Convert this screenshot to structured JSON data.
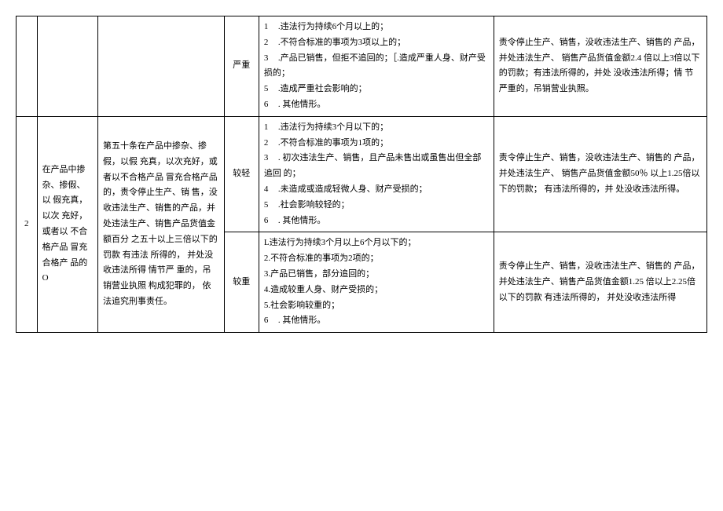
{
  "rows": [
    {
      "num": "",
      "violation": "",
      "basis": "",
      "severity": "严重",
      "circumstances_items": [
        {
          "n": "1",
          "t": ".违法行为持续6个月以上的；"
        },
        {
          "n": "2",
          "t": ".不符合标准的事项为3项以上的；"
        },
        {
          "n": "3",
          "t": ".产品已销售，但拒不追回的；［.造成严重人身、财产受损的；"
        },
        {
          "n": "5",
          "t": ".造成严重社会影响的；"
        },
        {
          "n": "6",
          "t": ". 其他情形。"
        }
      ],
      "penalty": "责令停止生产、销售，没收违法生产、销售的 产品，并处违法生产、 销售产品货值金额2.4  倍以上3倍以下的罚款；有违法所得的，并处 没收违法所得；情 节严重的，吊销营业执照。"
    },
    {
      "num": "2",
      "violation": "在产品中掺 杂、掺假、以 假充真，以次 充好，或者以 不合格产品  冒充合格产  品的O",
      "basis": "第五十条在产品中掺杂、掺假，以假 充真，以次充好，或者以不合格产品 冒充合格产品的，责令停止生产、销 售，没收违法生产、销售的产品，并 处违法生产、销售产品货值金额百分   之五十以上三倍以下的 罚款 有违法  所得的， 并处没收违法所得 情节严  重的，吊销营业执照 构成犯罪的， 依法追究刑事责任。",
      "severity_a": "较轻",
      "circumstances_a_items": [
        {
          "n": "1",
          "t": ".违法行为持续3个月以下的；"
        },
        {
          "n": "2",
          "t": ".不符合标准的事项为1项的；"
        },
        {
          "n": "3",
          "t": ". 初次违法生产、销售，且产品未售出或虽售出但全部追回  的；"
        },
        {
          "n": "4",
          "t": ".未造成或造成轻微人身、财产受损的；"
        },
        {
          "n": "5",
          "t": ".社会影响较轻的；"
        },
        {
          "n": "6",
          "t": ". 其他情形。"
        }
      ],
      "penalty_a": "责令停止生产、销售，没收违法生产、销售的 产品，并处违法生产、 销售产品货值金额50％ 以上1.25倍以下的罚款； 有违法所得的，并 处没收违法所得。",
      "severity_b": "较重",
      "circumstances_b_items": [
        {
          "n": "",
          "t": "L违法行为持续3个月以上6个月以下的；"
        },
        {
          "n": "",
          "t": "2.不符合标准的事项为2项的；"
        },
        {
          "n": "",
          "t": "3.产品已销售，部分追回的；"
        },
        {
          "n": "",
          "t": "4.造成较重人身、财产受损的；"
        },
        {
          "n": "",
          "t": "5.社会影响较重的；"
        },
        {
          "n": "6",
          "t": ". 其他情形。"
        }
      ],
      "penalty_b": "责令停止生产、销售，没收违法生产、销售的 产品，并处违法生产、销售产品货值金额1.25  倍以上2.25倍以下的罚款 有违法所得的，   并处没收违法所得"
    }
  ]
}
